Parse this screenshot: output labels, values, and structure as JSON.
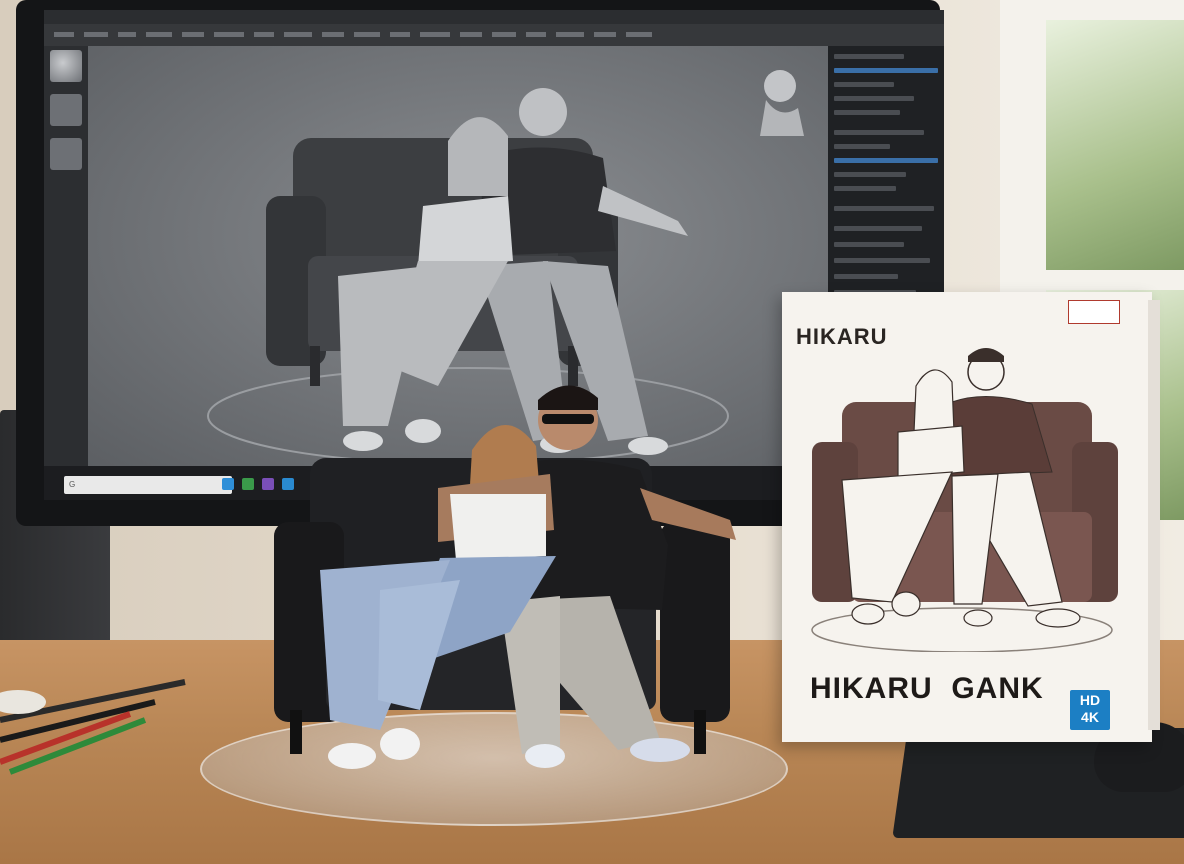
{
  "box": {
    "title_top": "HIKARU",
    "title_bottom": "HIKARU  GANK",
    "badge": {
      "line1": "HD",
      "line2": "4K"
    },
    "colors": {
      "box": "#f6f3ee",
      "sofa_art": "#6a4b45",
      "badge": "#1c7fc4"
    }
  },
  "monitor": {
    "icons": [
      "search-icon",
      "browser-icon",
      "folder-icon",
      "app-icon",
      "app-icon-2"
    ]
  },
  "colors": {
    "desk": "#b98756",
    "wall": "#e2d8c9",
    "sofa": "#1f2023",
    "viewport": "#6f7276"
  }
}
